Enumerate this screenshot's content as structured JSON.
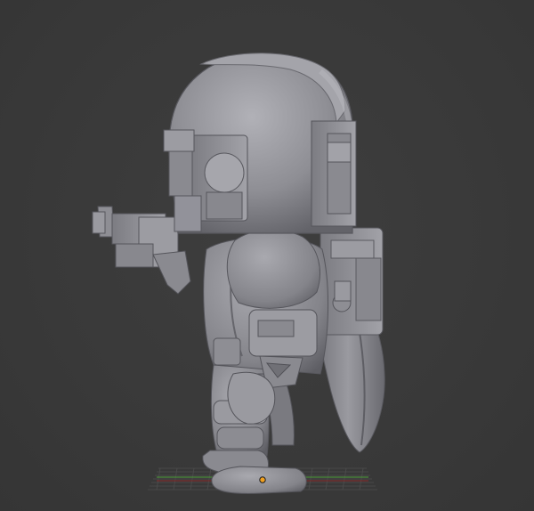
{
  "viewport": {
    "background_color": "#3a3a3a",
    "grid_color": "#4d4d4d",
    "x_axis_color": "#7a2d2d",
    "y_axis_color": "#4a8a3a",
    "origin_color": "#f0a020"
  },
  "model": {
    "icon": "sculpted-figure-icon",
    "base_color": "#8f8f95",
    "shadow_color": "#5c5c62",
    "highlight_color": "#b4b4ba"
  }
}
